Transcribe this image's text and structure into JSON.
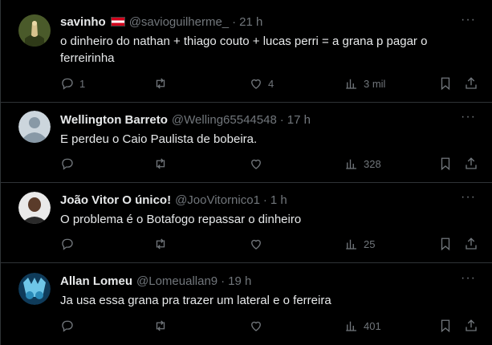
{
  "tweets": [
    {
      "name": "savinho",
      "has_flag": true,
      "handle": "@savioguilherme_",
      "dot": "·",
      "time": "21 h",
      "text": "o dinheiro do nathan + thiago couto + lucas perri = a grana p pagar o ferreirinha",
      "replies": "1",
      "retweets": "",
      "likes": "4",
      "views": "3 mil",
      "avatar_colors": [
        "#3b4a1c",
        "#c8b27a"
      ]
    },
    {
      "name": "Wellington Barreto",
      "has_flag": false,
      "handle": "@Welling65544548",
      "dot": "·",
      "time": "17 h",
      "text": "E perdeu o Caio Paulista de bobeira.",
      "replies": "",
      "retweets": "",
      "likes": "",
      "views": "328",
      "avatar_colors": [
        "#ccd6dd",
        "#8899a6"
      ]
    },
    {
      "name": "João Vitor O único!",
      "has_flag": false,
      "handle": "@JooVitornico1",
      "dot": "·",
      "time": "1 h",
      "text": "O problema é o Botafogo repassar o dinheiro",
      "replies": "",
      "retweets": "",
      "likes": "",
      "views": "25",
      "avatar_colors": [
        "#e8e8e8",
        "#5a3b2a"
      ]
    },
    {
      "name": "Allan Lomeu",
      "has_flag": false,
      "handle": "@Lomeuallan9",
      "dot": "·",
      "time": "19 h",
      "text": "Ja usa essa grana pra trazer um lateral e o ferreira",
      "replies": "",
      "retweets": "",
      "likes": "",
      "views": "401",
      "avatar_colors": [
        "#1c5a8a",
        "#6ec6e8"
      ]
    }
  ],
  "more_label": "···",
  "icons": [
    "reply-icon",
    "retweet-icon",
    "like-icon",
    "views-icon",
    "bookmark-icon",
    "share-icon",
    "more-icon",
    "flag-icon"
  ]
}
